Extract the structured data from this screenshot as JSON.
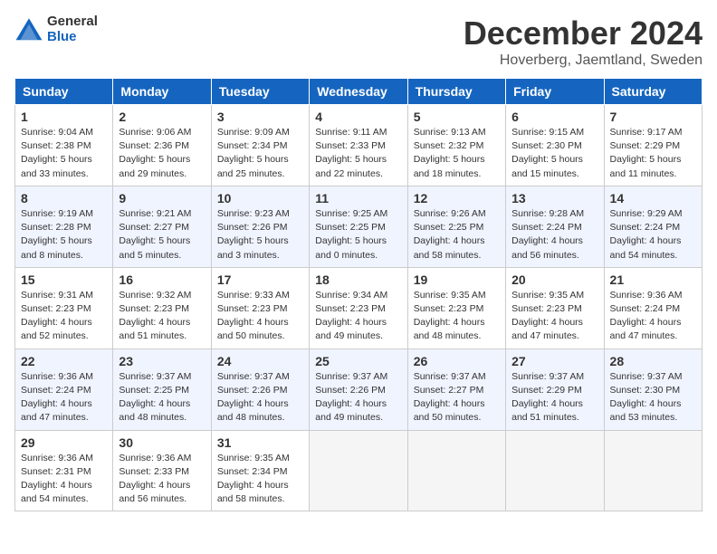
{
  "header": {
    "logo_general": "General",
    "logo_blue": "Blue",
    "month": "December 2024",
    "location": "Hoverberg, Jaemtland, Sweden"
  },
  "weekdays": [
    "Sunday",
    "Monday",
    "Tuesday",
    "Wednesday",
    "Thursday",
    "Friday",
    "Saturday"
  ],
  "weeks": [
    [
      {
        "day": "1",
        "info": "Sunrise: 9:04 AM\nSunset: 2:38 PM\nDaylight: 5 hours\nand 33 minutes."
      },
      {
        "day": "2",
        "info": "Sunrise: 9:06 AM\nSunset: 2:36 PM\nDaylight: 5 hours\nand 29 minutes."
      },
      {
        "day": "3",
        "info": "Sunrise: 9:09 AM\nSunset: 2:34 PM\nDaylight: 5 hours\nand 25 minutes."
      },
      {
        "day": "4",
        "info": "Sunrise: 9:11 AM\nSunset: 2:33 PM\nDaylight: 5 hours\nand 22 minutes."
      },
      {
        "day": "5",
        "info": "Sunrise: 9:13 AM\nSunset: 2:32 PM\nDaylight: 5 hours\nand 18 minutes."
      },
      {
        "day": "6",
        "info": "Sunrise: 9:15 AM\nSunset: 2:30 PM\nDaylight: 5 hours\nand 15 minutes."
      },
      {
        "day": "7",
        "info": "Sunrise: 9:17 AM\nSunset: 2:29 PM\nDaylight: 5 hours\nand 11 minutes."
      }
    ],
    [
      {
        "day": "8",
        "info": "Sunrise: 9:19 AM\nSunset: 2:28 PM\nDaylight: 5 hours\nand 8 minutes."
      },
      {
        "day": "9",
        "info": "Sunrise: 9:21 AM\nSunset: 2:27 PM\nDaylight: 5 hours\nand 5 minutes."
      },
      {
        "day": "10",
        "info": "Sunrise: 9:23 AM\nSunset: 2:26 PM\nDaylight: 5 hours\nand 3 minutes."
      },
      {
        "day": "11",
        "info": "Sunrise: 9:25 AM\nSunset: 2:25 PM\nDaylight: 5 hours\nand 0 minutes."
      },
      {
        "day": "12",
        "info": "Sunrise: 9:26 AM\nSunset: 2:25 PM\nDaylight: 4 hours\nand 58 minutes."
      },
      {
        "day": "13",
        "info": "Sunrise: 9:28 AM\nSunset: 2:24 PM\nDaylight: 4 hours\nand 56 minutes."
      },
      {
        "day": "14",
        "info": "Sunrise: 9:29 AM\nSunset: 2:24 PM\nDaylight: 4 hours\nand 54 minutes."
      }
    ],
    [
      {
        "day": "15",
        "info": "Sunrise: 9:31 AM\nSunset: 2:23 PM\nDaylight: 4 hours\nand 52 minutes."
      },
      {
        "day": "16",
        "info": "Sunrise: 9:32 AM\nSunset: 2:23 PM\nDaylight: 4 hours\nand 51 minutes."
      },
      {
        "day": "17",
        "info": "Sunrise: 9:33 AM\nSunset: 2:23 PM\nDaylight: 4 hours\nand 50 minutes."
      },
      {
        "day": "18",
        "info": "Sunrise: 9:34 AM\nSunset: 2:23 PM\nDaylight: 4 hours\nand 49 minutes."
      },
      {
        "day": "19",
        "info": "Sunrise: 9:35 AM\nSunset: 2:23 PM\nDaylight: 4 hours\nand 48 minutes."
      },
      {
        "day": "20",
        "info": "Sunrise: 9:35 AM\nSunset: 2:23 PM\nDaylight: 4 hours\nand 47 minutes."
      },
      {
        "day": "21",
        "info": "Sunrise: 9:36 AM\nSunset: 2:24 PM\nDaylight: 4 hours\nand 47 minutes."
      }
    ],
    [
      {
        "day": "22",
        "info": "Sunrise: 9:36 AM\nSunset: 2:24 PM\nDaylight: 4 hours\nand 47 minutes."
      },
      {
        "day": "23",
        "info": "Sunrise: 9:37 AM\nSunset: 2:25 PM\nDaylight: 4 hours\nand 48 minutes."
      },
      {
        "day": "24",
        "info": "Sunrise: 9:37 AM\nSunset: 2:26 PM\nDaylight: 4 hours\nand 48 minutes."
      },
      {
        "day": "25",
        "info": "Sunrise: 9:37 AM\nSunset: 2:26 PM\nDaylight: 4 hours\nand 49 minutes."
      },
      {
        "day": "26",
        "info": "Sunrise: 9:37 AM\nSunset: 2:27 PM\nDaylight: 4 hours\nand 50 minutes."
      },
      {
        "day": "27",
        "info": "Sunrise: 9:37 AM\nSunset: 2:29 PM\nDaylight: 4 hours\nand 51 minutes."
      },
      {
        "day": "28",
        "info": "Sunrise: 9:37 AM\nSunset: 2:30 PM\nDaylight: 4 hours\nand 53 minutes."
      }
    ],
    [
      {
        "day": "29",
        "info": "Sunrise: 9:36 AM\nSunset: 2:31 PM\nDaylight: 4 hours\nand 54 minutes."
      },
      {
        "day": "30",
        "info": "Sunrise: 9:36 AM\nSunset: 2:33 PM\nDaylight: 4 hours\nand 56 minutes."
      },
      {
        "day": "31",
        "info": "Sunrise: 9:35 AM\nSunset: 2:34 PM\nDaylight: 4 hours\nand 58 minutes."
      },
      {
        "day": "",
        "info": ""
      },
      {
        "day": "",
        "info": ""
      },
      {
        "day": "",
        "info": ""
      },
      {
        "day": "",
        "info": ""
      }
    ]
  ]
}
